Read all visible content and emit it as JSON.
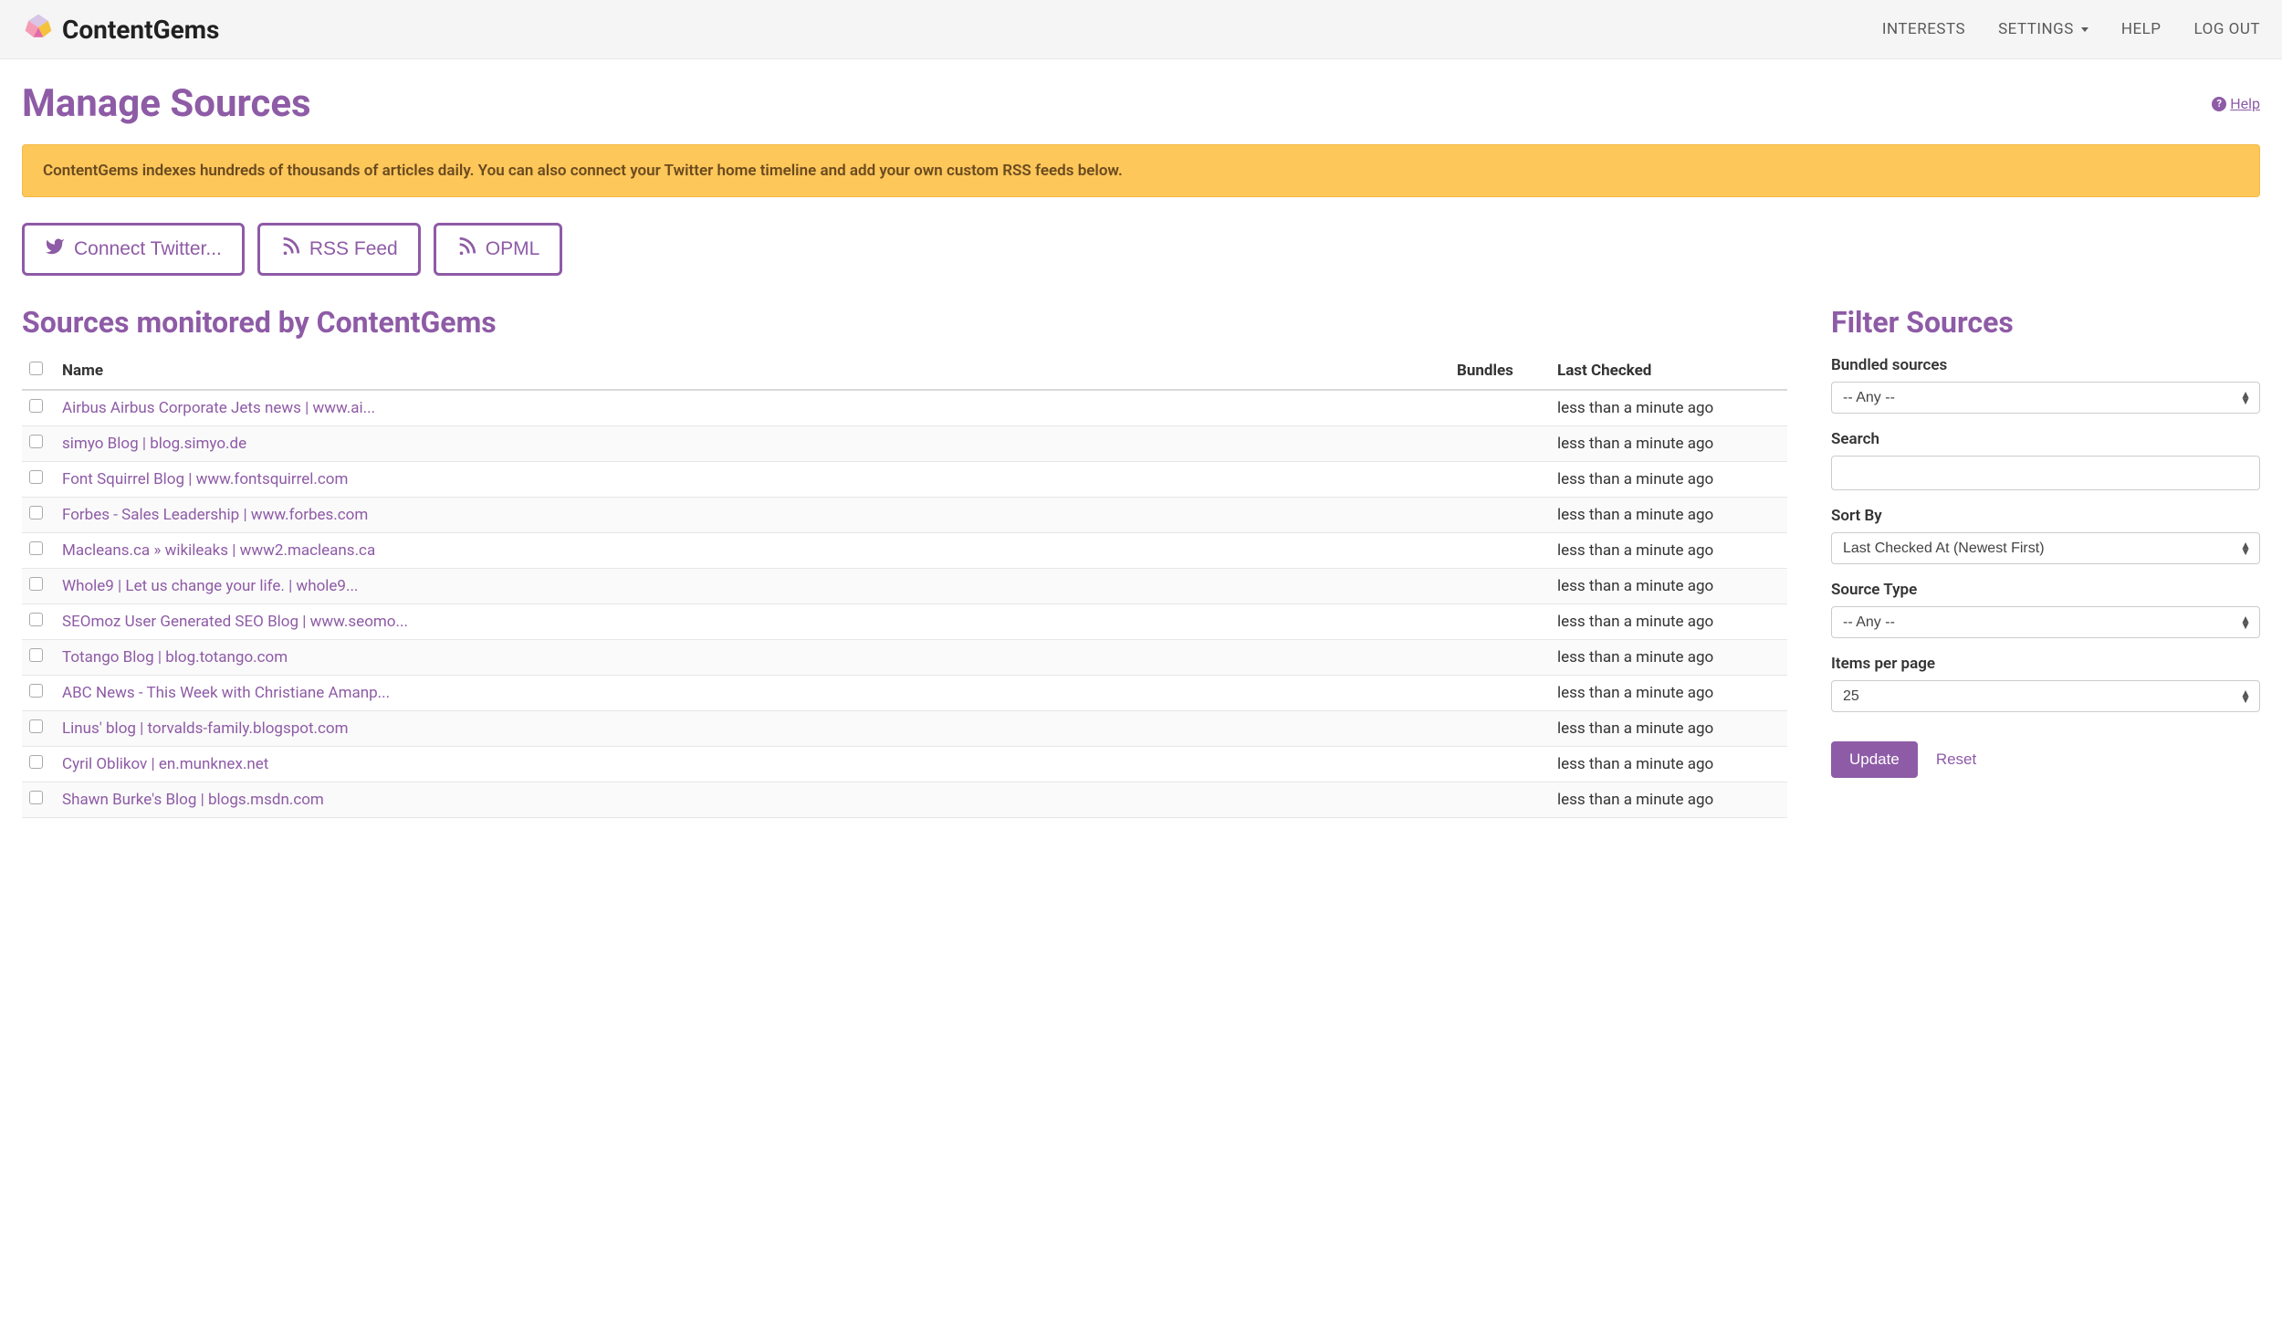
{
  "brand": "ContentGems",
  "nav": {
    "interests": "INTERESTS",
    "settings": "SETTINGS",
    "help": "HELP",
    "logout": "LOG OUT"
  },
  "page": {
    "title": "Manage Sources",
    "help_label": "Help"
  },
  "banner": "ContentGems indexes hundreds of thousands of articles daily. You can also connect your Twitter home timeline and add your own custom RSS feeds below.",
  "buttons": {
    "twitter": "Connect Twitter...",
    "rss": "RSS Feed",
    "opml": "OPML"
  },
  "sources_section_title": "Sources monitored by ContentGems",
  "columns": {
    "name": "Name",
    "bundles": "Bundles",
    "last_checked": "Last Checked"
  },
  "sources": [
    {
      "name": "Airbus Airbus Corporate Jets news | www.ai...",
      "bundles": "",
      "last_checked": "less than a minute ago"
    },
    {
      "name": "simyo Blog | blog.simyo.de",
      "bundles": "",
      "last_checked": "less than a minute ago"
    },
    {
      "name": "Font Squirrel Blog | www.fontsquirrel.com",
      "bundles": "",
      "last_checked": "less than a minute ago"
    },
    {
      "name": "Forbes - Sales Leadership | www.forbes.com",
      "bundles": "",
      "last_checked": "less than a minute ago"
    },
    {
      "name": "Macleans.ca » wikileaks | www2.macleans.ca",
      "bundles": "",
      "last_checked": "less than a minute ago"
    },
    {
      "name": "Whole9 | Let us change your life. | whole9...",
      "bundles": "",
      "last_checked": "less than a minute ago"
    },
    {
      "name": "SEOmoz User Generated SEO Blog | www.seomo...",
      "bundles": "",
      "last_checked": "less than a minute ago"
    },
    {
      "name": "Totango Blog | blog.totango.com",
      "bundles": "",
      "last_checked": "less than a minute ago"
    },
    {
      "name": "ABC News - This Week with Christiane Amanp...",
      "bundles": "",
      "last_checked": "less than a minute ago"
    },
    {
      "name": "Linus' blog | torvalds-family.blogspot.com",
      "bundles": "",
      "last_checked": "less than a minute ago"
    },
    {
      "name": "Cyril Oblikov | en.munknex.net",
      "bundles": "",
      "last_checked": "less than a minute ago"
    },
    {
      "name": "Shawn Burke's Blog | blogs.msdn.com",
      "bundles": "",
      "last_checked": "less than a minute ago"
    }
  ],
  "filter": {
    "title": "Filter Sources",
    "bundled_label": "Bundled sources",
    "bundled_value": "-- Any --",
    "search_label": "Search",
    "search_value": "",
    "sort_label": "Sort By",
    "sort_value": "Last Checked At (Newest First)",
    "type_label": "Source Type",
    "type_value": "-- Any --",
    "per_page_label": "Items per page",
    "per_page_value": "25",
    "update": "Update",
    "reset": "Reset"
  }
}
